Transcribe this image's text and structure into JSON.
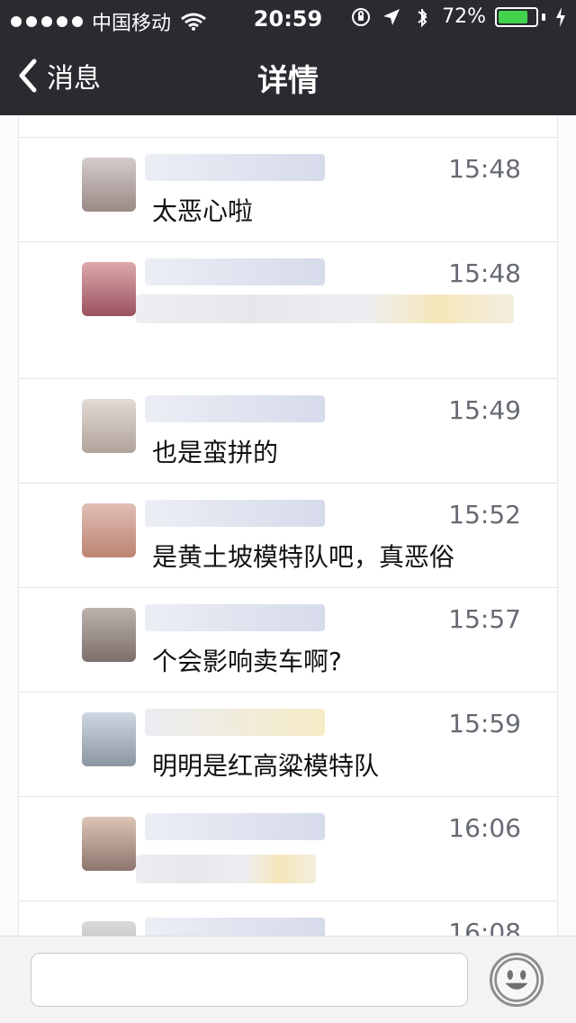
{
  "status_bar": {
    "carrier": "中国移动",
    "time": "20:59",
    "battery_percent": "72%"
  },
  "nav": {
    "back_label": "消息",
    "title": "详情"
  },
  "messages": [
    {
      "time": "15:48",
      "text": "太恶心啦"
    },
    {
      "time": "15:48",
      "text": ""
    },
    {
      "time": "15:49",
      "text": "也是蛮拼的"
    },
    {
      "time": "15:52",
      "text": "是黄土坡模特队吧，真恶俗"
    },
    {
      "time": "15:57",
      "text": "个会影响卖车啊?"
    },
    {
      "time": "15:59",
      "text": "明明是红高粱模特队"
    },
    {
      "time": "16:06",
      "text": ""
    },
    {
      "time": "16:08",
      "text": ""
    }
  ],
  "composer": {
    "placeholder": ""
  },
  "colors": {
    "header_bg": "#2a2b30",
    "battery_green": "#42d34e"
  },
  "icons": {
    "wifi": "wifi-icon",
    "lock": "orientation-lock-icon",
    "location": "location-arrow-icon",
    "bluetooth": "bluetooth-icon",
    "battery": "battery-icon",
    "charging": "charging-bolt-icon",
    "back": "chevron-left-icon",
    "emoji": "emoji-icon"
  }
}
